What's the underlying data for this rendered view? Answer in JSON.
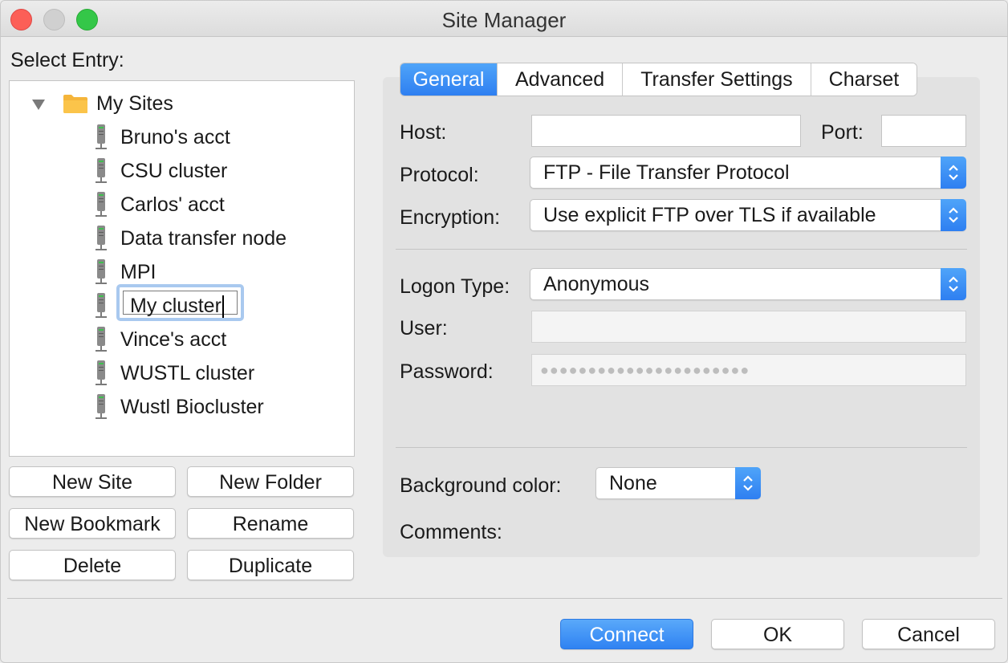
{
  "window": {
    "title": "Site Manager"
  },
  "left": {
    "select_entry_label": "Select Entry:",
    "tree": {
      "root": "My Sites",
      "items": [
        "Bruno's acct",
        "CSU cluster",
        "Carlos' acct",
        "Data transfer node",
        "MPI",
        "My cluster",
        "Vince's acct",
        "WUSTL cluster",
        "Wustl Biocluster"
      ],
      "editing_value": "My cluster"
    },
    "buttons": {
      "new_site": "New Site",
      "new_folder": "New Folder",
      "new_bookmark": "New Bookmark",
      "rename": "Rename",
      "delete": "Delete",
      "duplicate": "Duplicate"
    }
  },
  "tabs": [
    "General",
    "Advanced",
    "Transfer Settings",
    "Charset"
  ],
  "general": {
    "host_label": "Host:",
    "host_value": "",
    "port_label": "Port:",
    "port_value": "",
    "protocol_label": "Protocol:",
    "protocol_value": "FTP - File Transfer Protocol",
    "encryption_label": "Encryption:",
    "encryption_value": "Use explicit FTP over TLS if available",
    "logon_label": "Logon Type:",
    "logon_value": "Anonymous",
    "user_label": "User:",
    "user_value": "",
    "password_label": "Password:",
    "password_mask": "●●●●●●●●●●●●●●●●●●●●●●",
    "bgcolor_label": "Background color:",
    "bgcolor_value": "None",
    "comments_label": "Comments:"
  },
  "footer": {
    "connect": "Connect",
    "ok": "OK",
    "cancel": "Cancel"
  },
  "colors": {
    "accent": "#2e7ff1",
    "folder": "#f5b53a",
    "close": "#fc5f57",
    "maximize": "#34c748"
  }
}
